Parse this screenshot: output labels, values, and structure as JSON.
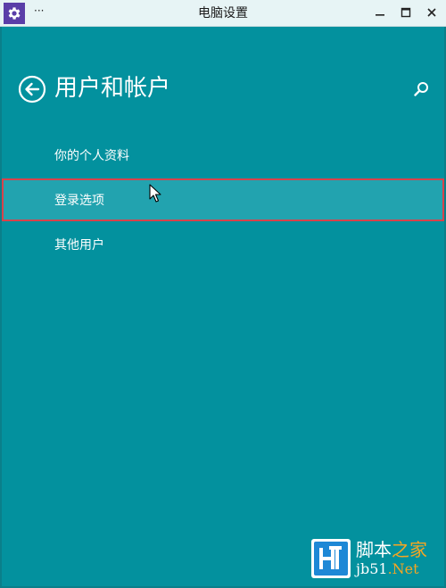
{
  "window": {
    "title": "电脑设置",
    "menu_glyph": "···",
    "icon": "gear-icon",
    "controls": [
      "minimize-icon",
      "maximize-icon",
      "close-icon"
    ]
  },
  "header": {
    "title": "用户和帐户",
    "back_icon": "back-arrow-icon",
    "search_icon": "search-icon"
  },
  "menu": {
    "items": [
      {
        "label": "你的个人资料",
        "selected": false
      },
      {
        "label": "登录选项",
        "selected": true
      },
      {
        "label": "其他用户",
        "selected": false
      }
    ]
  },
  "watermark": {
    "line1_a": "脚本",
    "line1_b": "之家",
    "line2_a": "jb51",
    "line2_b": ".Net",
    "logo_letter": "H"
  },
  "colors": {
    "background": "#03919e",
    "selected_item": "#22a3af",
    "selection_outline": "#d8434b",
    "titlebar": "#e7f4f5",
    "app_icon": "#5a3ea8"
  }
}
